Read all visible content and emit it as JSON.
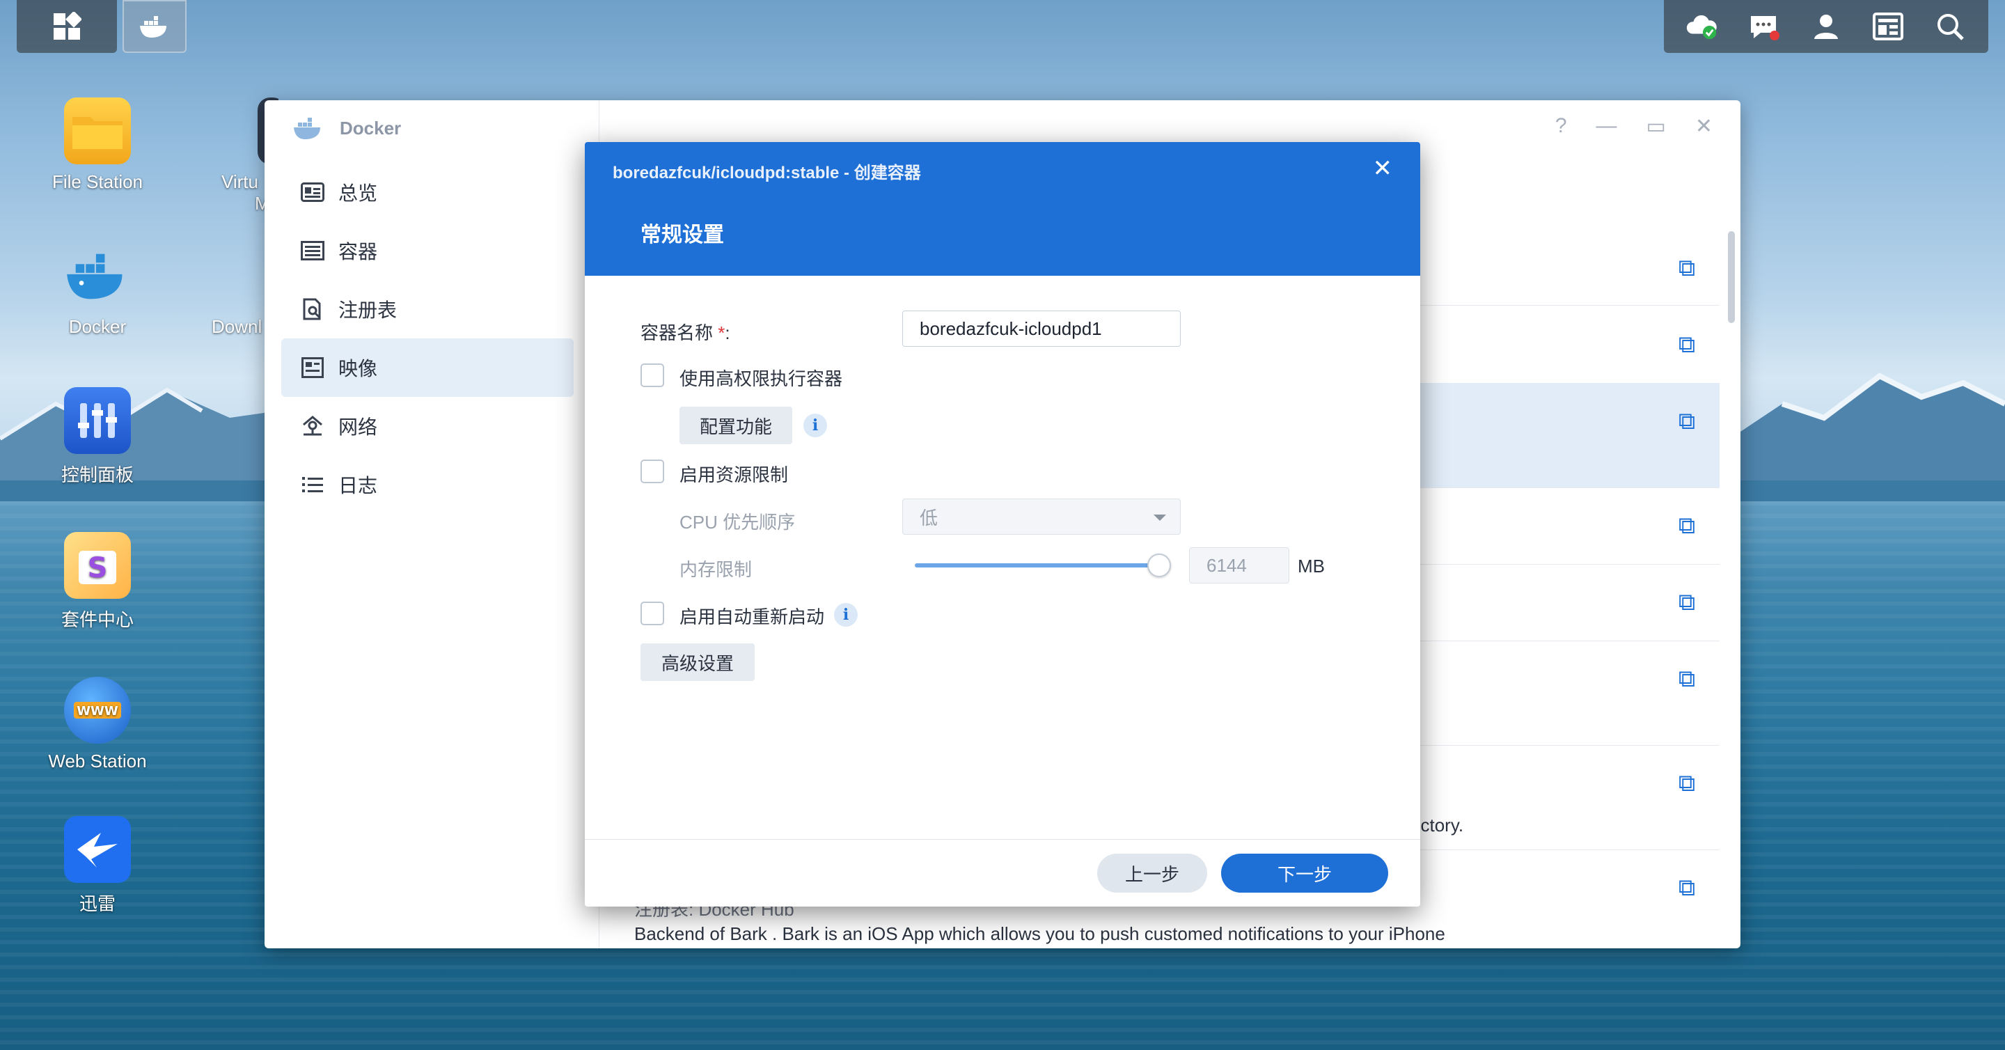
{
  "taskbar": {
    "left_icons": [
      "main-menu-icon",
      "docker-icon"
    ],
    "right_icons": [
      "cloud-sync-icon",
      "notification-icon",
      "user-icon",
      "widgets-icon",
      "search-icon"
    ]
  },
  "desktop": {
    "icons": [
      {
        "label": "File Station"
      },
      {
        "label": "Docker"
      },
      {
        "label": "控制面板"
      },
      {
        "label": "套件中心"
      },
      {
        "label": "Web Station"
      },
      {
        "label": "迅雷"
      }
    ],
    "partial_labels": [
      "Virtu",
      "M",
      "Downl"
    ]
  },
  "docker_window": {
    "title": "Docker",
    "controls": [
      "?",
      "—",
      "▭",
      "✕"
    ],
    "sidebar": [
      {
        "label": "总览",
        "icon": "overview-icon"
      },
      {
        "label": "容器",
        "icon": "container-icon"
      },
      {
        "label": "注册表",
        "icon": "registry-icon"
      },
      {
        "label": "映像",
        "icon": "image-icon"
      },
      {
        "label": "网络",
        "icon": "network-icon"
      },
      {
        "label": "日志",
        "icon": "log-icon"
      }
    ],
    "active_sidebar": "映像",
    "content": {
      "text_fragment_1": "ed directory.",
      "text_fragment_2": "注册表: Docker Hub",
      "text_fragment_3": "Backend of Bark . Bark is an iOS App which allows you to push customed notifications to your iPhone"
    }
  },
  "dialog": {
    "title": "boredazfcuk/icloudpd:stable - 创建容器",
    "subtitle": "常规设置",
    "container_name_label": "容器名称",
    "required_mark": "*",
    "colon": ":",
    "container_name_value": "boredazfcuk-icloudpd1",
    "privileged_label": "使用高权限执行容器",
    "privileged_checked": false,
    "config_button": "配置功能",
    "resource_limit_label": "启用资源限制",
    "resource_limit_checked": false,
    "cpu_label": "CPU 优先顺序",
    "cpu_value": "低",
    "memory_label": "内存限制",
    "memory_value": "6144",
    "memory_unit": "MB",
    "memory_slider_fraction": 1.0,
    "auto_restart_label": "启用自动重新启动",
    "auto_restart_checked": false,
    "advanced_button": "高级设置",
    "info_glyph": "i",
    "prev_button": "上一步",
    "next_button": "下一步"
  },
  "colors": {
    "accent": "#1e6fd6",
    "required": "#e0343a"
  }
}
